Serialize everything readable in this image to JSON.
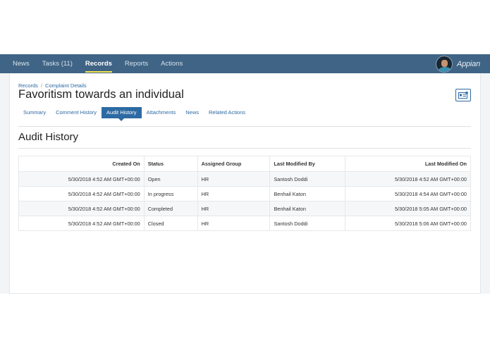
{
  "nav": {
    "items": [
      {
        "label": "News",
        "active": false
      },
      {
        "label": "Tasks (11)",
        "active": false
      },
      {
        "label": "Records",
        "active": true
      },
      {
        "label": "Reports",
        "active": false
      },
      {
        "label": "Actions",
        "active": false
      }
    ],
    "brand": "Appian",
    "avatar_icon": "user-avatar",
    "colors": {
      "bar": "#3f6485",
      "active_underline": "#f2e34c"
    }
  },
  "breadcrumb": {
    "root": "Records",
    "separator": "/",
    "current": "Complaint Details"
  },
  "page_title": "Favoritism towards an individual",
  "record_icon": "record-card-icon",
  "tabs": [
    {
      "label": "Summary",
      "active": false
    },
    {
      "label": "Comment History",
      "active": false
    },
    {
      "label": "Audit History",
      "active": true
    },
    {
      "label": "Attachments",
      "active": false
    },
    {
      "label": "News",
      "active": false
    },
    {
      "label": "Related Actions",
      "active": false
    }
  ],
  "section_title": "Audit History",
  "table": {
    "headers": [
      "Created On",
      "Status",
      "Assigned Group",
      "Last Modified By",
      "Last Modified On"
    ],
    "rows": [
      [
        "5/30/2018 4:52 AM GMT+00:00",
        "Open",
        "HR",
        "Santosh Doddi",
        "5/30/2018 4:52 AM GMT+00:00"
      ],
      [
        "5/30/2018 4:52 AM GMT+00:00",
        "In progress",
        "HR",
        "Benhail Katon",
        "5/30/2018 4:54 AM GMT+00:00"
      ],
      [
        "5/30/2018 4:52 AM GMT+00:00",
        "Completed",
        "HR",
        "Benhail Katon",
        "5/30/2018 5:05 AM GMT+00:00"
      ],
      [
        "5/30/2018 4:52 AM GMT+00:00",
        "Closed",
        "HR",
        "Santosh Doddi",
        "5/30/2018 5:06 AM GMT+00:00"
      ]
    ]
  }
}
